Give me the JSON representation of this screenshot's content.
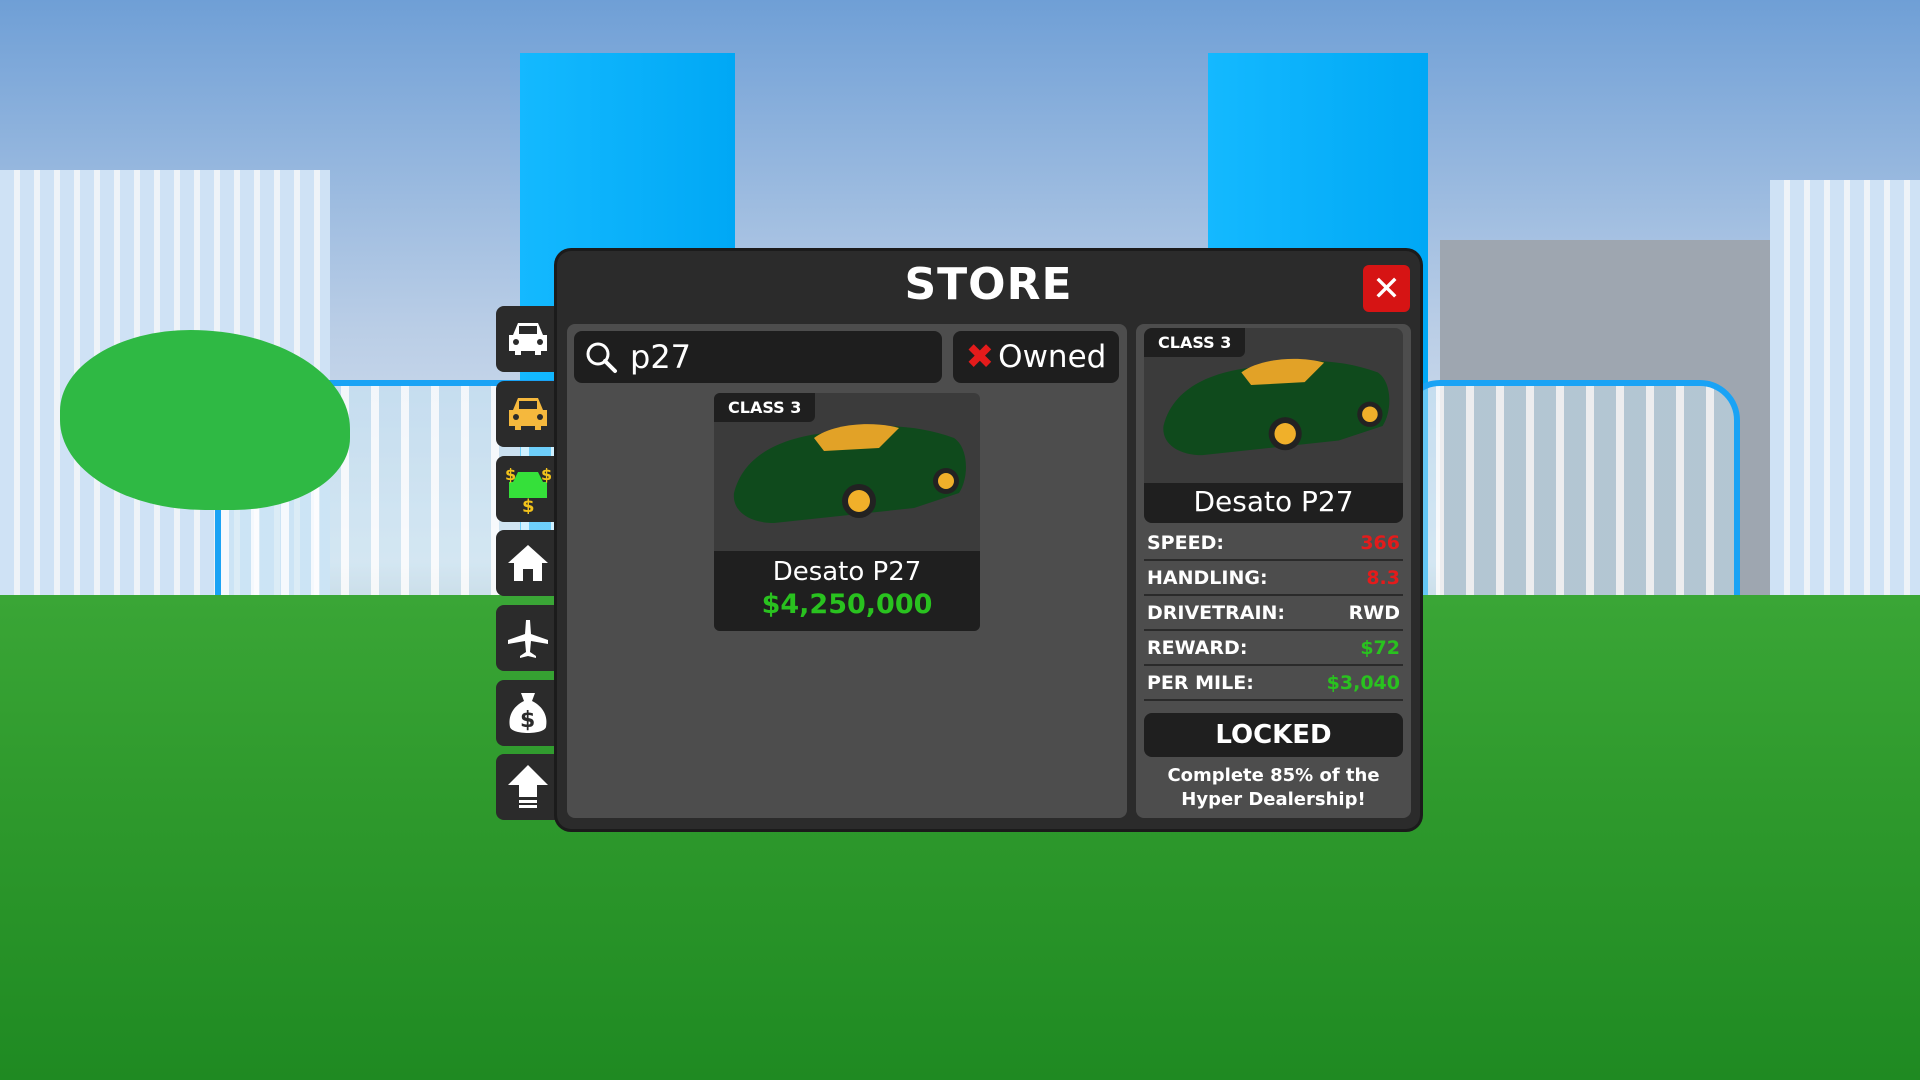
{
  "store": {
    "title": "STORE",
    "close_icon": "close-icon",
    "search": {
      "value": "p27",
      "icon": "search-icon"
    },
    "owned_filter": {
      "label": "Owned",
      "icon": "x-icon"
    },
    "sidebar": [
      {
        "name": "cars",
        "icon": "car-icon-white"
      },
      {
        "name": "taxis",
        "icon": "car-icon-yellow"
      },
      {
        "name": "money-cars",
        "icon": "car-dollar-icon"
      },
      {
        "name": "houses",
        "icon": "home-icon"
      },
      {
        "name": "planes",
        "icon": "plane-icon"
      },
      {
        "name": "money",
        "icon": "money-bag-icon"
      },
      {
        "name": "upgrades",
        "icon": "upgrade-arrow-icon"
      }
    ],
    "results": [
      {
        "class": "CLASS 3",
        "name": "Desato P27",
        "price": "$4,250,000"
      }
    ],
    "detail": {
      "class": "CLASS 3",
      "name": "Desato P27",
      "stats": [
        {
          "label": "SPEED:",
          "value": "366",
          "color": "#e41b1b"
        },
        {
          "label": "HANDLING:",
          "value": "8.3",
          "color": "#e41b1b"
        },
        {
          "label": "DRIVETRAIN:",
          "value": "RWD",
          "color": "#ffffff"
        },
        {
          "label": "REWARD:",
          "value": "$72",
          "color": "#29c21f"
        },
        {
          "label": "PER MILE:",
          "value": "$3,040",
          "color": "#29c21f"
        }
      ],
      "status": "LOCKED",
      "requirement_line1": "Complete 85% of the",
      "requirement_line2": "Hyper Dealership!"
    }
  }
}
